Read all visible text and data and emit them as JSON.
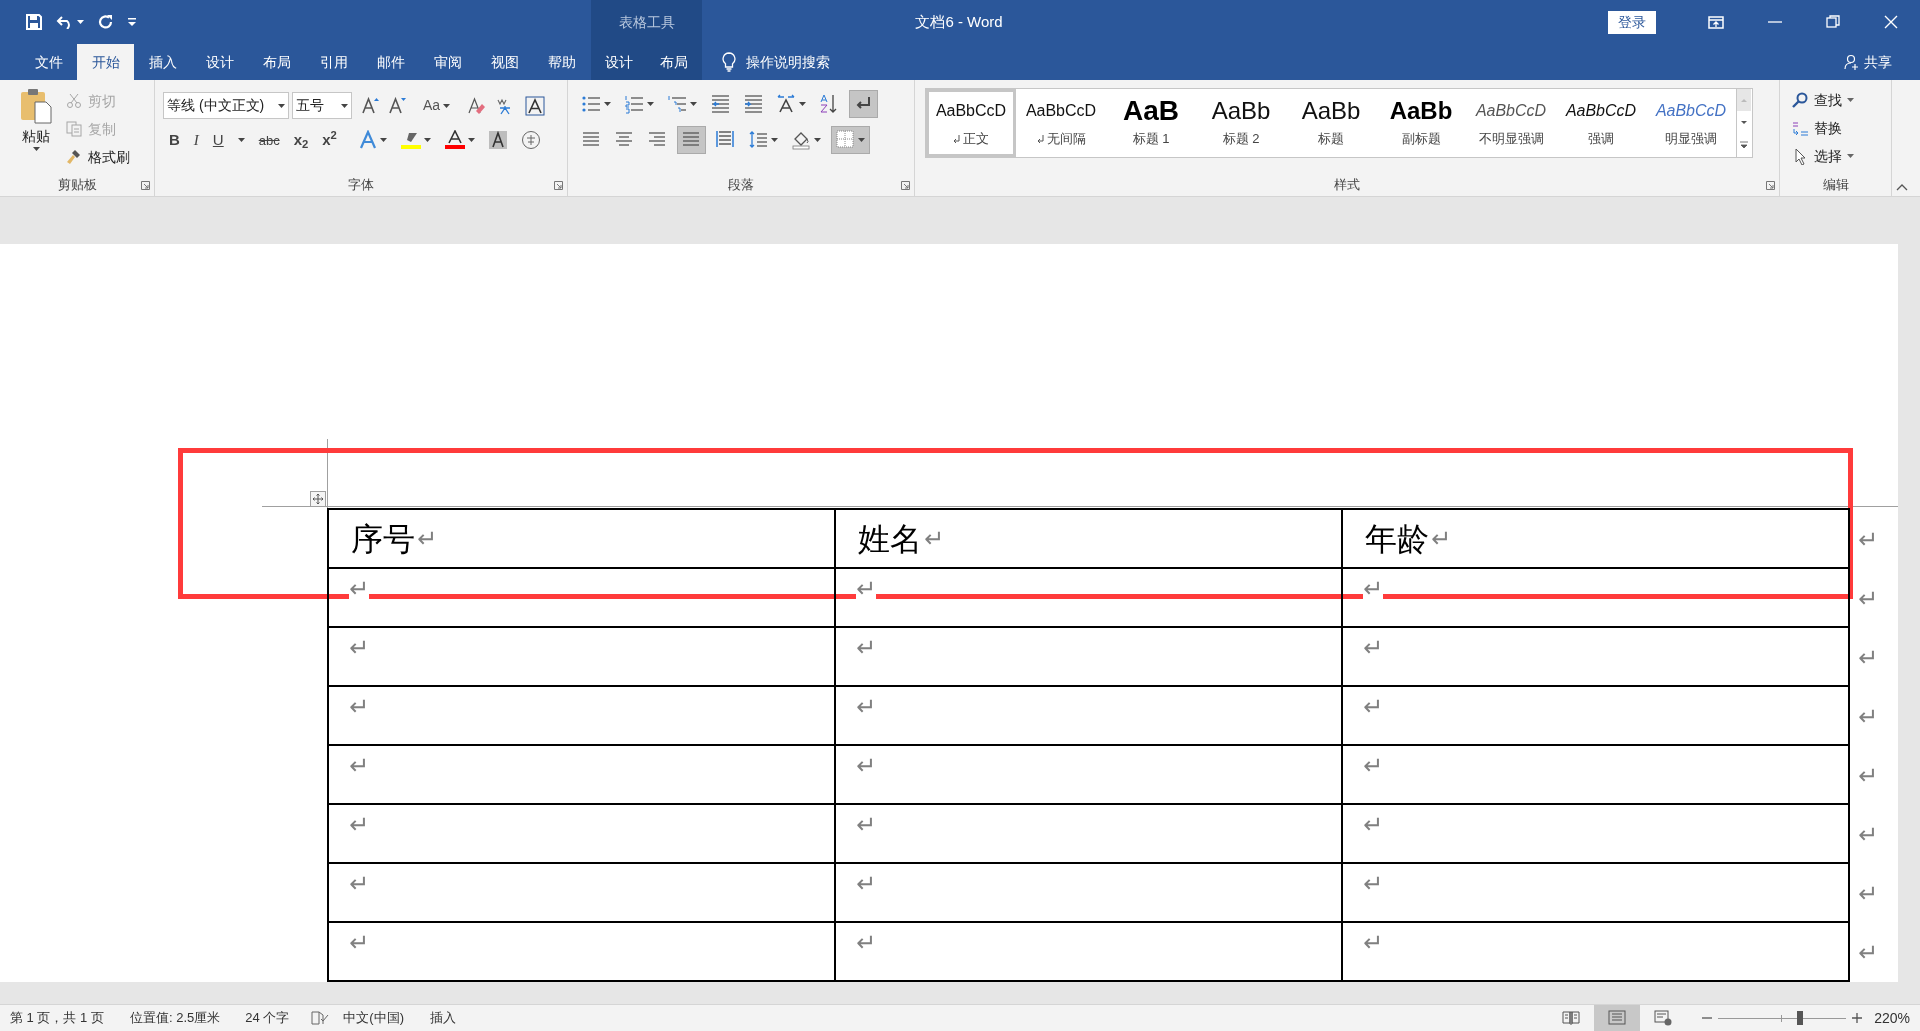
{
  "title_bar": {
    "title": "文档6  -  Word",
    "contextual_label": "表格工具",
    "sign_in": "登录"
  },
  "tabs": [
    {
      "label": "文件",
      "selected": false,
      "kind": "main"
    },
    {
      "label": "开始",
      "selected": true,
      "kind": "main"
    },
    {
      "label": "插入",
      "selected": false,
      "kind": "main"
    },
    {
      "label": "设计",
      "selected": false,
      "kind": "main"
    },
    {
      "label": "布局",
      "selected": false,
      "kind": "main"
    },
    {
      "label": "引用",
      "selected": false,
      "kind": "main"
    },
    {
      "label": "邮件",
      "selected": false,
      "kind": "main"
    },
    {
      "label": "审阅",
      "selected": false,
      "kind": "main"
    },
    {
      "label": "视图",
      "selected": false,
      "kind": "main"
    },
    {
      "label": "帮助",
      "selected": false,
      "kind": "main"
    },
    {
      "label": "设计",
      "selected": false,
      "kind": "contextual"
    },
    {
      "label": "布局",
      "selected": false,
      "kind": "contextual"
    }
  ],
  "tell_me": "操作说明搜索",
  "share": "共享",
  "ribbon": {
    "clipboard": {
      "label": "剪贴板",
      "paste": "粘贴",
      "items": [
        {
          "label": "剪切",
          "disabled": true,
          "kind": "cut"
        },
        {
          "label": "复制",
          "disabled": true,
          "kind": "copy"
        },
        {
          "label": "格式刷",
          "disabled": false,
          "kind": "painter"
        }
      ]
    },
    "font": {
      "label": "字体",
      "font_name": "等线 (中文正文)",
      "font_size": "五号",
      "change_case": "Aa",
      "format_buttons": [
        {
          "label": "B",
          "kind": "bold"
        },
        {
          "label": "I",
          "kind": "italic"
        },
        {
          "label": "U",
          "kind": "underline"
        },
        {
          "label": "abc",
          "kind": "strike"
        },
        {
          "label": "x$_{2}$",
          "kind": "sub"
        },
        {
          "label": "x$^{2}$",
          "kind": "sup"
        }
      ]
    },
    "paragraph": {
      "label": "段落",
      "row1": [
        {
          "kind": "bullets",
          "pressed": false
        },
        {
          "kind": "numbering",
          "pressed": false
        },
        {
          "kind": "multilevel",
          "pressed": false
        },
        {
          "kind": "outdent",
          "pressed": false
        },
        {
          "kind": "indent",
          "pressed": false
        },
        {
          "kind": "layout",
          "pressed": false
        },
        {
          "kind": "sort",
          "pressed": false
        },
        {
          "kind": "marks",
          "pressed": true
        }
      ],
      "row2": [
        {
          "kind": "left",
          "pressed": false
        },
        {
          "kind": "center",
          "pressed": false
        },
        {
          "kind": "right",
          "pressed": false
        },
        {
          "kind": "justify",
          "pressed": true
        },
        {
          "kind": "distributed",
          "pressed": false
        },
        {
          "kind": "spacing",
          "pressed": false
        },
        {
          "kind": "shading",
          "pressed": false
        },
        {
          "kind": "borders",
          "pressed": true
        }
      ]
    },
    "styles": {
      "label": "样式",
      "items": [
        {
          "preview": "AaBbCcD",
          "name": "正文",
          "kind": "normal",
          "para_mark": true,
          "selected": true
        },
        {
          "preview": "AaBbCcD",
          "name": "无间隔",
          "kind": "normal",
          "para_mark": true,
          "selected": false
        },
        {
          "preview": "AaB",
          "name": "标题 1",
          "kind": "h1",
          "para_mark": false,
          "selected": false
        },
        {
          "preview": "AaBb",
          "name": "标题 2",
          "kind": "h2",
          "para_mark": false,
          "selected": false
        },
        {
          "preview": "AaBb",
          "name": "标题",
          "kind": "h2",
          "para_mark": false,
          "selected": false
        },
        {
          "preview": "AaBb",
          "name": "副标题",
          "kind": "subtitle",
          "para_mark": false,
          "selected": false
        },
        {
          "preview": "AaBbCcD",
          "name": "不明显强调",
          "kind": "subtle",
          "para_mark": false,
          "selected": false
        },
        {
          "preview": "AaBbCcD",
          "name": "强调",
          "kind": "emphasis",
          "para_mark": false,
          "selected": false
        },
        {
          "preview": "AaBbCcD",
          "name": "明显强调",
          "kind": "intense",
          "para_mark": false,
          "selected": false
        }
      ]
    },
    "editing": {
      "label": "编辑",
      "items": [
        {
          "label": "查找",
          "kind": "find"
        },
        {
          "label": "替换",
          "kind": "replace"
        },
        {
          "label": "选择",
          "kind": "select"
        }
      ]
    }
  },
  "table": {
    "header": [
      {
        "text": "序号",
        "mark": "↵"
      },
      {
        "text": "姓名",
        "mark": "↵"
      },
      {
        "text": "年龄",
        "mark": "↵"
      }
    ],
    "header_end": "↵",
    "rows": [
      {
        "cells": [
          "↵",
          "↵",
          "↵"
        ],
        "end": "↵"
      },
      {
        "cells": [
          "↵",
          "↵",
          "↵"
        ],
        "end": "↵"
      },
      {
        "cells": [
          "↵",
          "↵",
          "↵"
        ],
        "end": "↵"
      },
      {
        "cells": [
          "↵",
          "↵",
          "↵"
        ],
        "end": "↵"
      },
      {
        "cells": [
          "↵",
          "↵",
          "↵"
        ],
        "end": "↵"
      },
      {
        "cells": [
          "↵",
          "↵",
          "↵"
        ],
        "end": "↵"
      },
      {
        "cells": [
          "↵",
          "↵",
          "↵"
        ],
        "end": "↵"
      }
    ]
  },
  "status_bar": {
    "page": "第 1 页，共 1 页",
    "position": "位置值: 2.5厘米",
    "words": "24 个字",
    "language": "中文(中国)",
    "mode": "插入",
    "views": [
      {
        "kind": "read",
        "selected": false
      },
      {
        "kind": "print",
        "selected": true
      },
      {
        "kind": "web",
        "selected": false
      }
    ],
    "zoom": {
      "level": 0.64,
      "label": "220%"
    }
  }
}
